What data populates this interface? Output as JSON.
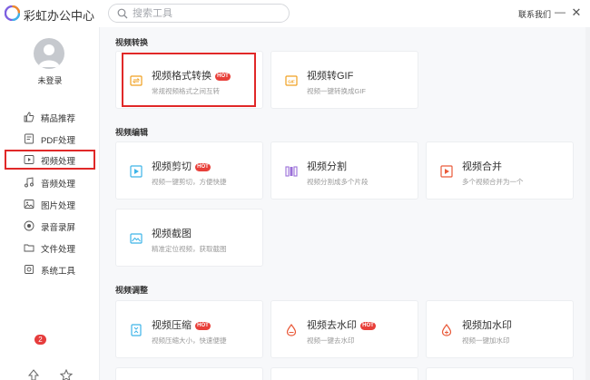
{
  "app": {
    "title": "彩虹办公中心",
    "search_placeholder": "搜索工具",
    "contact": "联系我们",
    "minimize": "—",
    "close": "✕"
  },
  "sidebar": {
    "login": "未登录",
    "items": [
      {
        "label": "精品推荐",
        "icon": "thumbs-up-icon"
      },
      {
        "label": "PDF处理",
        "icon": "pdf-icon"
      },
      {
        "label": "视频处理",
        "icon": "video-icon",
        "active": true
      },
      {
        "label": "音频处理",
        "icon": "music-icon"
      },
      {
        "label": "图片处理",
        "icon": "image-icon"
      },
      {
        "label": "录音录屏",
        "icon": "record-icon"
      },
      {
        "label": "文件处理",
        "icon": "folder-icon"
      },
      {
        "label": "系统工具",
        "icon": "system-icon"
      }
    ],
    "badge_count": "2"
  },
  "sections": [
    {
      "title": "视频转换",
      "cards": [
        {
          "title": "视频格式转换",
          "hot": "HOT",
          "desc": "常规视频格式之间互转"
        },
        {
          "title": "视频转GIF",
          "desc": "视频一键转换成GIF"
        }
      ]
    },
    {
      "title": "视频编辑",
      "cards": [
        {
          "title": "视频剪切",
          "hot": "HOT",
          "desc": "视频一键剪切，方便快捷"
        },
        {
          "title": "视频分割",
          "desc": "视频分割成多个片段"
        },
        {
          "title": "视频合并",
          "desc": "多个视频合并为一个"
        },
        {
          "title": "视频截图",
          "desc": "精准定位视频，获取截图"
        }
      ]
    },
    {
      "title": "视频调整",
      "cards": [
        {
          "title": "视频压缩",
          "hot": "HOT",
          "desc": "视频压缩大小，快速便捷"
        },
        {
          "title": "视频去水印",
          "hot": "HOT",
          "desc": "视频一键去水印"
        },
        {
          "title": "视频加水印",
          "desc": "视频一键加水印"
        }
      ]
    }
  ],
  "colors": {
    "accent": "#f0a020",
    "highlight": "#e02828",
    "hot": "#e8403a",
    "watermark_icon": "#e95a3a",
    "split_icon": "#9b6fd8"
  }
}
